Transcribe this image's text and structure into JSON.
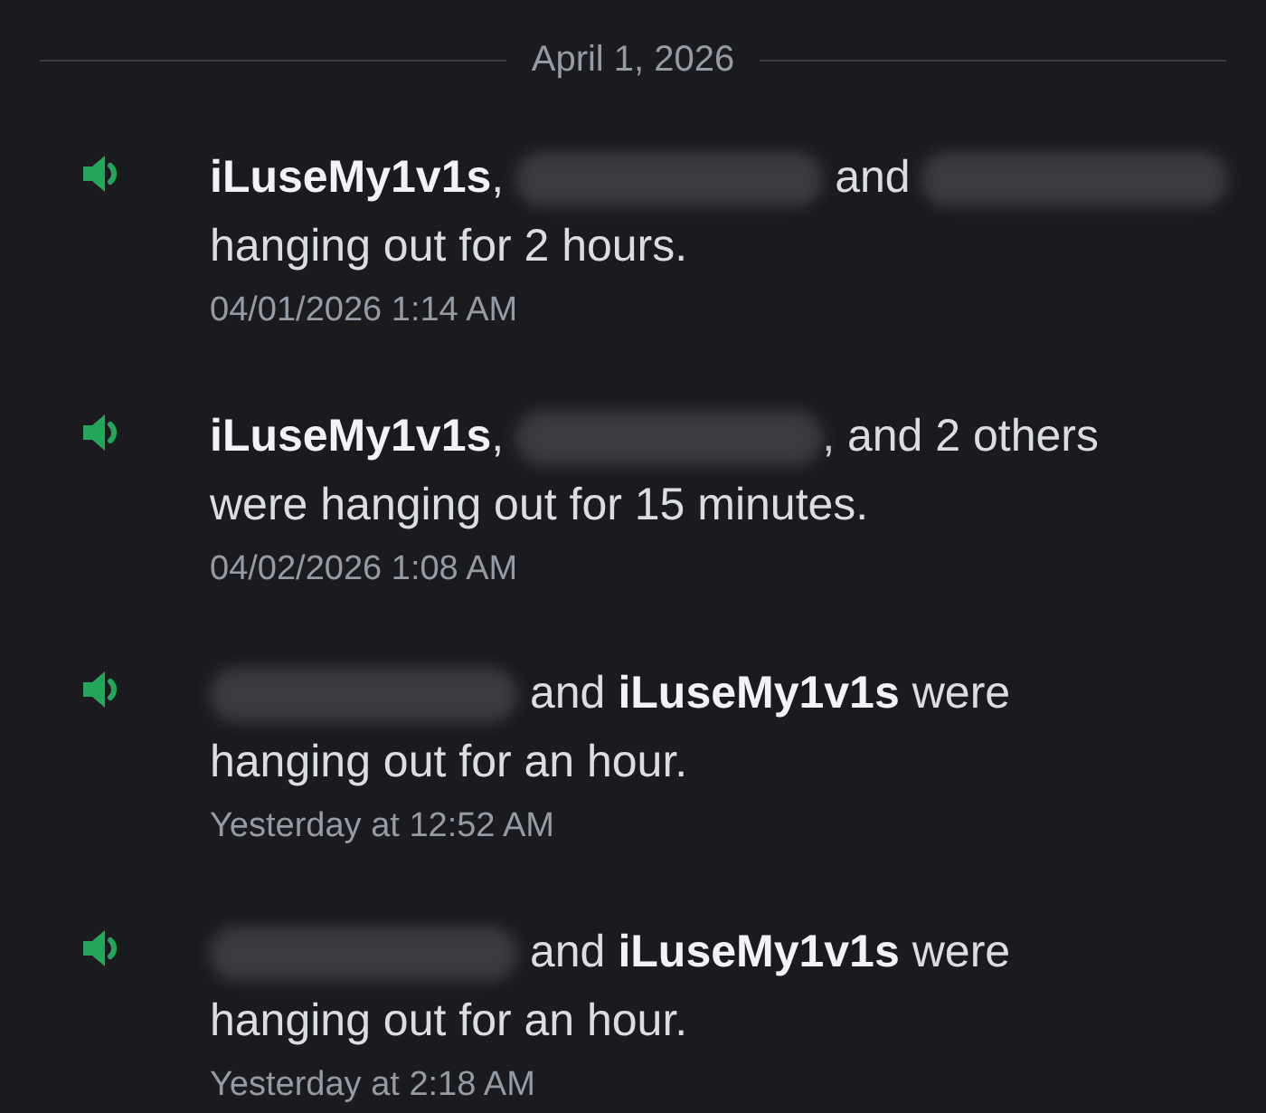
{
  "date_divider": "April 1, 2026",
  "entries": [
    {
      "lines": [
        [
          {
            "kind": "name",
            "text": "iLuseMy1v1s"
          },
          {
            "kind": "text",
            "text": ","
          },
          {
            "kind": "redacted"
          },
          {
            "kind": "text",
            "text": "and"
          },
          {
            "kind": "redacted"
          }
        ],
        [
          {
            "kind": "text",
            "text": "hanging out for 2 hours."
          }
        ]
      ],
      "timestamp": "04/01/2026 1:14 AM"
    },
    {
      "lines": [
        [
          {
            "kind": "name",
            "text": "iLuseMy1v1s"
          },
          {
            "kind": "text",
            "text": ","
          },
          {
            "kind": "redacted"
          },
          {
            "kind": "text",
            "text": ", and 2 others"
          }
        ],
        [
          {
            "kind": "text",
            "text": "were hanging out for 15 minutes."
          }
        ]
      ],
      "timestamp": "04/02/2026 1:08 AM"
    },
    {
      "lines": [
        [
          {
            "kind": "redacted"
          },
          {
            "kind": "text",
            "text": "and"
          },
          {
            "kind": "name",
            "text": "iLuseMy1v1s"
          },
          {
            "kind": "text",
            "text": "were"
          }
        ],
        [
          {
            "kind": "text",
            "text": "hanging out for an hour."
          }
        ]
      ],
      "timestamp": "Yesterday at 12:52 AM"
    },
    {
      "lines": [
        [
          {
            "kind": "redacted"
          },
          {
            "kind": "text",
            "text": "and"
          },
          {
            "kind": "name",
            "text": "iLuseMy1v1s"
          },
          {
            "kind": "text",
            "text": "were"
          }
        ],
        [
          {
            "kind": "text",
            "text": "hanging out for an hour."
          }
        ]
      ],
      "timestamp": "Yesterday at 2:18 AM"
    }
  ]
}
